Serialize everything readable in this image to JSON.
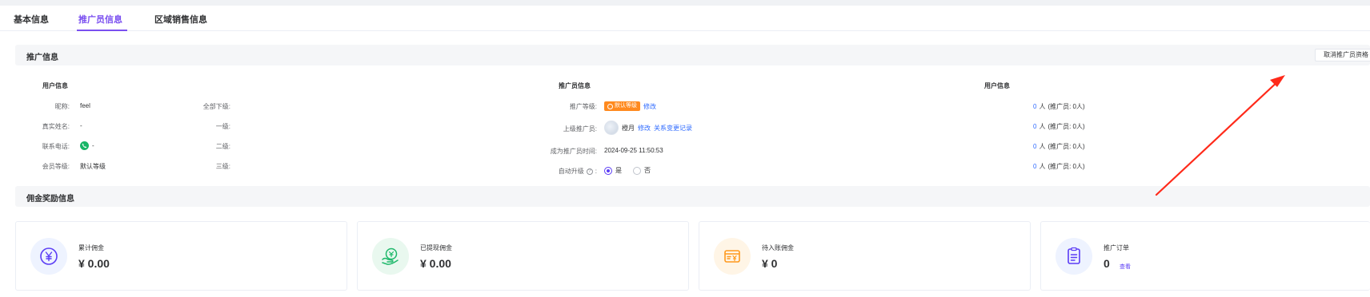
{
  "tabs": [
    {
      "label": "基本信息"
    },
    {
      "label": "推广员信息"
    },
    {
      "label": "区域销售信息"
    }
  ],
  "promoter_section": {
    "title": "推广信息",
    "cancel_button": "取消推广员资格"
  },
  "user_info": {
    "title": "用户信息",
    "rows": [
      {
        "label": "昵称:",
        "value": "feel"
      },
      {
        "label": "真实姓名:",
        "value": "-"
      },
      {
        "label": "联系电话:",
        "value": "-"
      },
      {
        "label": "会员等级:",
        "value": "默认等级"
      }
    ]
  },
  "promoter_info": {
    "title": "推广员信息",
    "level_label": "推广等级:",
    "level_badge": "默认等级",
    "level_edit": "修改",
    "parent_label": "上级推广员:",
    "parent_name": "橙月",
    "parent_edit": "修改",
    "parent_history": "关系变更记录",
    "since_label": "成为推广员时间:",
    "since_value": "2024-09-25 11:50:53",
    "auto_label": "自动升级",
    "auto_suffix": ":",
    "auto_yes": "是",
    "auto_no": "否",
    "auto_selected": "是"
  },
  "downline_info": {
    "title": "用户信息",
    "rows": [
      {
        "label": "全部下级:",
        "count": "0",
        "unit": "人",
        "promoters": "(推广员: 0人)"
      },
      {
        "label": "一级:",
        "count": "0",
        "unit": "人",
        "promoters": "(推广员: 0人)"
      },
      {
        "label": "二级:",
        "count": "0",
        "unit": "人",
        "promoters": "(推广员: 0人)"
      },
      {
        "label": "三级:",
        "count": "0",
        "unit": "人",
        "promoters": "(推广员: 0人)"
      }
    ]
  },
  "commission_section": {
    "title": "佣金奖励信息"
  },
  "cards": [
    {
      "label": "累计佣金",
      "value": "¥ 0.00",
      "icon": "yen-circle-icon",
      "color": "#5b3df5",
      "bg": "#eef3ff"
    },
    {
      "label": "已提现佣金",
      "value": "¥ 0.00",
      "icon": "hand-coin-icon",
      "color": "#1fb86b",
      "bg": "#e9f8ef"
    },
    {
      "label": "待入账佣金",
      "value": "¥ 0",
      "icon": "wallet-icon",
      "color": "#ff9a1f",
      "bg": "#fff5e6"
    },
    {
      "label": "推广订单",
      "value": "0",
      "link": "查看",
      "icon": "order-list-icon",
      "color": "#5b3df5",
      "bg": "#eef3ff"
    }
  ],
  "colors": {
    "accent": "#7a4ff0",
    "link": "#2f6bff",
    "badge": "#ff8a1f",
    "annotation_arrow": "#ff2a1a"
  }
}
